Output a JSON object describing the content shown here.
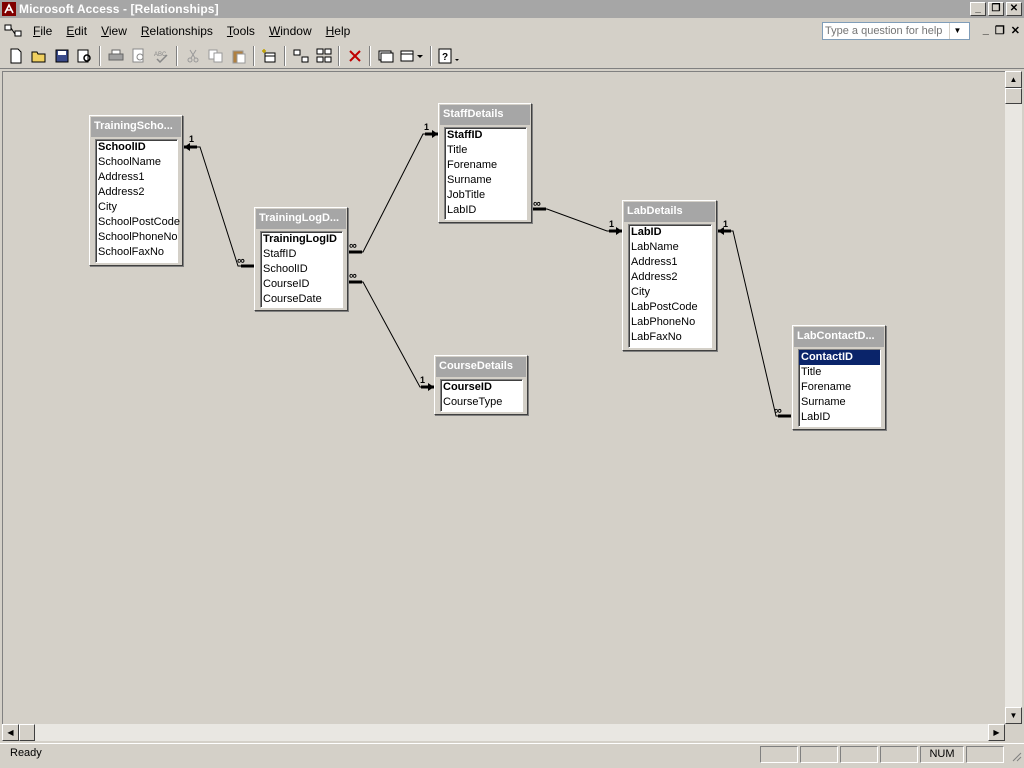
{
  "window": {
    "title": "Microsoft Access - [Relationships]"
  },
  "menu": [
    {
      "label": "File",
      "key": "F",
      "rest": "ile"
    },
    {
      "label": "Edit",
      "key": "E",
      "rest": "dit"
    },
    {
      "label": "View",
      "key": "V",
      "rest": "iew"
    },
    {
      "label": "Relationships",
      "key": "R",
      "rest": "elationships"
    },
    {
      "label": "Tools",
      "key": "T",
      "rest": "ools"
    },
    {
      "label": "Window",
      "key": "W",
      "rest": "indow"
    },
    {
      "label": "Help",
      "key": "H",
      "rest": "elp"
    }
  ],
  "help_search": {
    "placeholder": "Type a question for help"
  },
  "status": {
    "text": "Ready",
    "num": "NUM"
  },
  "tables": {
    "training_schools": {
      "title": "TrainingScho...",
      "fields": [
        "SchoolID",
        "SchoolName",
        "Address1",
        "Address2",
        "City",
        "SchoolPostCode",
        "SchoolPhoneNo",
        "SchoolFaxNo"
      ]
    },
    "training_log": {
      "title": "TrainingLogD...",
      "fields": [
        "TrainingLogID",
        "StaffID",
        "SchoolID",
        "CourseID",
        "CourseDate"
      ]
    },
    "staff_details": {
      "title": "StaffDetails",
      "fields": [
        "StaffID",
        "Title",
        "Forename",
        "Surname",
        "JobTitle",
        "LabID"
      ]
    },
    "course_details": {
      "title": "CourseDetails",
      "fields": [
        "CourseID",
        "CourseType"
      ]
    },
    "lab_details": {
      "title": "LabDetails",
      "fields": [
        "LabID",
        "LabName",
        "Address1",
        "Address2",
        "City",
        "LabPostCode",
        "LabPhoneNo",
        "LabFaxNo"
      ]
    },
    "lab_contacts": {
      "title": "LabContactD...",
      "fields": [
        "ContactID",
        "Title",
        "Forename",
        "Surname",
        "LabID"
      ]
    }
  },
  "relationship_labels": {
    "one": "1",
    "many": "∞"
  }
}
